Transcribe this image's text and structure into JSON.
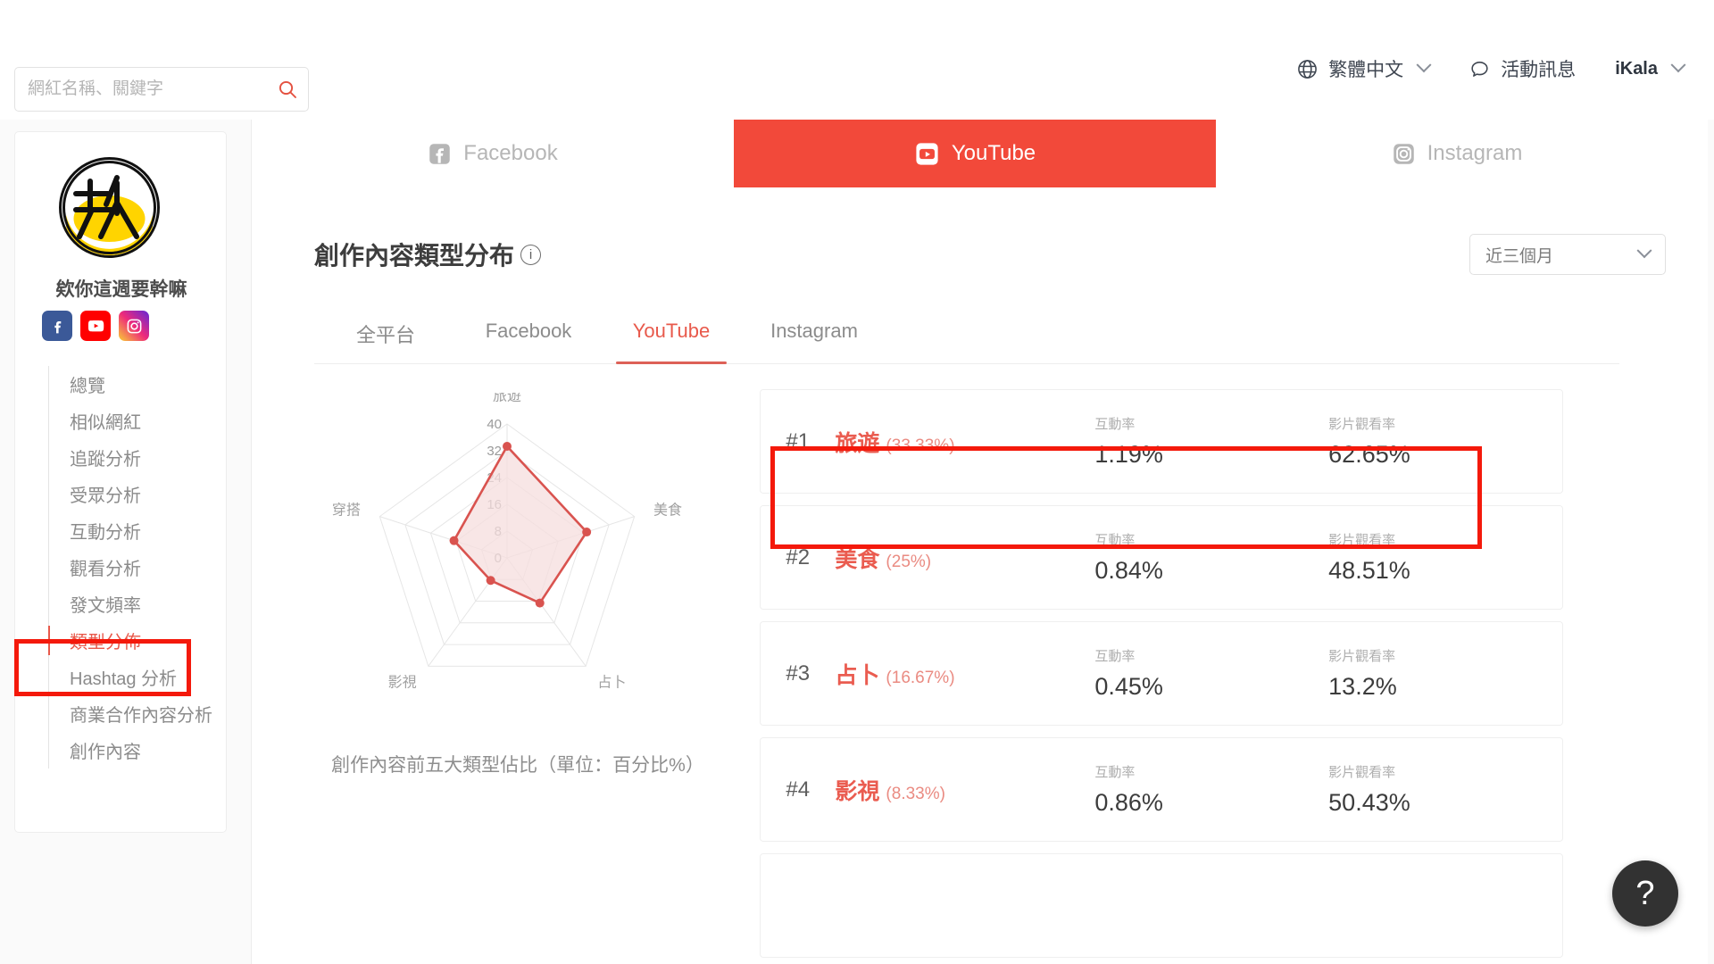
{
  "header": {
    "search": {
      "placeholder": "網紅名稱、關鍵字",
      "value": "",
      "icon": "search-icon"
    },
    "language": {
      "label": "繁體中文",
      "icon": "globe-icon"
    },
    "news": {
      "label": "活動訊息",
      "icon": "speech-bubble-icon"
    },
    "user": {
      "label": "iKala"
    }
  },
  "sidebar": {
    "profile": {
      "name": "欸你這週要幹嘛",
      "avatar_alt": "欸你這週要幹嘛 channel logo",
      "socials": [
        {
          "name": "facebook-icon",
          "color": "#3b5998"
        },
        {
          "name": "youtube-icon",
          "color": "#ff0000"
        },
        {
          "name": "instagram-icon",
          "color": "#ee2a7b"
        }
      ]
    },
    "items": [
      {
        "label": "總覽",
        "active": false
      },
      {
        "label": "相似網紅",
        "active": false
      },
      {
        "label": "追蹤分析",
        "active": false
      },
      {
        "label": "受眾分析",
        "active": false
      },
      {
        "label": "互動分析",
        "active": false
      },
      {
        "label": "觀看分析",
        "active": false
      },
      {
        "label": "發文頻率",
        "active": false
      },
      {
        "label": "類型分佈",
        "active": true
      },
      {
        "label": "Hashtag 分析",
        "active": false
      },
      {
        "label": "商業合作內容分析",
        "active": false
      },
      {
        "label": "創作內容",
        "active": false
      }
    ]
  },
  "main": {
    "platform_tabs": [
      {
        "label": "Facebook",
        "icon": "facebook-icon",
        "active": false
      },
      {
        "label": "YouTube",
        "icon": "youtube-icon",
        "active": true
      },
      {
        "label": "Instagram",
        "icon": "instagram-icon",
        "active": false
      }
    ],
    "panel_title": "創作內容類型分布",
    "info_icon": "info-icon",
    "range_select": {
      "value": "近三個月",
      "icon": "chevron-down-icon"
    },
    "sub_tabs": [
      {
        "label": "全平台",
        "active": false
      },
      {
        "label": "Facebook",
        "active": false
      },
      {
        "label": "YouTube",
        "active": true
      },
      {
        "label": "Instagram",
        "active": false
      }
    ],
    "chart_caption": "創作內容前五大類型佔比（單位：百分比%）",
    "ranking_headers": {
      "engagement": "互動率",
      "view_rate": "影片觀看率"
    },
    "rankings": [
      {
        "rank": "#1",
        "category": "旅遊",
        "share": "(33.33%)",
        "engagement": "1.19%",
        "view_rate": "62.65%"
      },
      {
        "rank": "#2",
        "category": "美食",
        "share": "(25%)",
        "engagement": "0.84%",
        "view_rate": "48.51%"
      },
      {
        "rank": "#3",
        "category": "占卜",
        "share": "(16.67%)",
        "engagement": "0.45%",
        "view_rate": "13.2%"
      },
      {
        "rank": "#4",
        "category": "影視",
        "share": "(8.33%)",
        "engagement": "0.86%",
        "view_rate": "50.43%"
      }
    ]
  },
  "help_button": {
    "label": "?",
    "icon": "question-mark-icon"
  },
  "colors": {
    "accent_red": "#f2493a",
    "text_red": "#e8594b",
    "annotation_red": "#f4190b",
    "radar_line": "#d9534f",
    "radar_fill": "#f6dedd"
  },
  "chart_data": {
    "type": "radar",
    "title": "",
    "caption": "創作內容前五大類型佔比（單位：百分比%）",
    "categories": [
      "旅遊",
      "美食",
      "占卜",
      "影視",
      "穿搭"
    ],
    "values": [
      33.33,
      25,
      16.67,
      8.33,
      16.67
    ],
    "tick_labels": [
      "0",
      "8",
      "16",
      "24",
      "32",
      "40"
    ],
    "ticks": [
      0,
      8,
      16,
      24,
      32,
      40
    ],
    "rlim": [
      0,
      40
    ],
    "grid": true,
    "legend": "none",
    "ylabel": "百分比%",
    "xlabel": ""
  }
}
